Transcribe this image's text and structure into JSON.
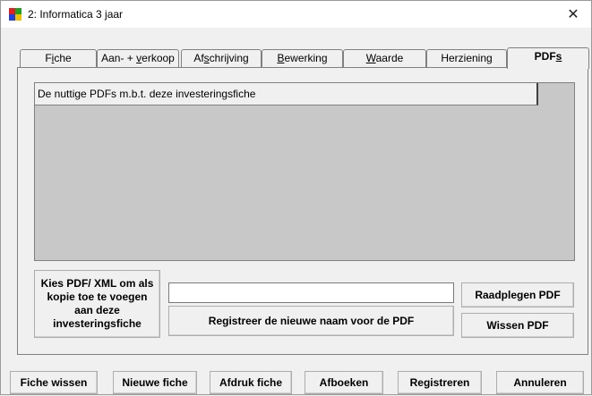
{
  "window": {
    "title": "2: Informatica 3 jaar",
    "close_glyph": "✕"
  },
  "app_icon": {
    "name": "app-icon",
    "colors": [
      "#e02020",
      "#20a020",
      "#2040e0",
      "#f0c000"
    ]
  },
  "tabs": [
    {
      "pre": "F",
      "u": "i",
      "post": "che"
    },
    {
      "pre": "Aan- + ",
      "u": "v",
      "post": "erkoop"
    },
    {
      "pre": "Af",
      "u": "s",
      "post": "chrijving"
    },
    {
      "pre": "",
      "u": "B",
      "post": "ewerking"
    },
    {
      "pre": "",
      "u": "W",
      "post": "aarde"
    },
    {
      "pre": "Herziening",
      "u": "",
      "post": ""
    },
    {
      "pre": "PDF",
      "u": "s",
      "post": ""
    }
  ],
  "active_tab": 6,
  "pdf_list": {
    "header": "De nuttige PDFs m.b.t. deze investeringsfiche"
  },
  "buttons": {
    "choose_pdf": "Kies PDF/ XML om als kopie toe te voegen aan deze investeringsfiche",
    "register_name": "Registreer de nieuwe naam voor de PDF",
    "view_pdf": "Raadplegen PDF",
    "delete_pdf": "Wissen PDF"
  },
  "filename_input": {
    "value": ""
  },
  "footer": {
    "delete_fiche": "Fiche wissen",
    "new_fiche": "Nieuwe fiche",
    "print_fiche": "Afdruk fiche",
    "write_off": "Afboeken",
    "register": "Registreren",
    "cancel": "Annuleren"
  }
}
